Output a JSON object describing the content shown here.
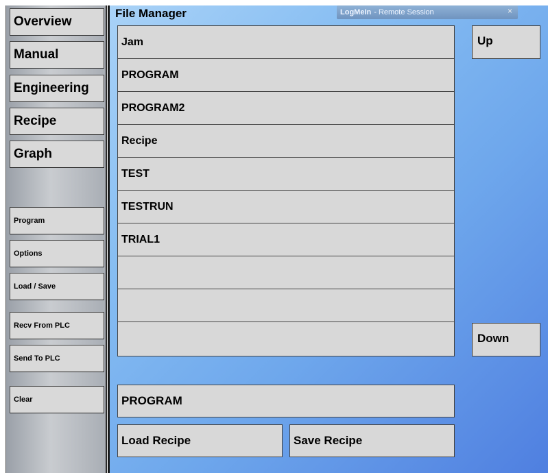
{
  "sidebar": {
    "nav": [
      "Overview",
      "Manual",
      "Engineering",
      "Recipe",
      "Graph"
    ],
    "actions": [
      "Program",
      "Options",
      "Load / Save",
      "Recv From PLC",
      "Send To PLC",
      "Clear"
    ]
  },
  "main": {
    "title": "File Manager",
    "files": [
      "Jam",
      "PROGRAM",
      "PROGRAM2",
      "Recipe",
      "TEST",
      "TESTRUN",
      "TRIAL1",
      "",
      "",
      ""
    ],
    "up_label": "Up",
    "down_label": "Down",
    "selected_recipe": "PROGRAM",
    "load_label": "Load Recipe",
    "save_label": "Save Recipe"
  },
  "logmein": {
    "brand": "LogMeIn",
    "session": "- Remote Session",
    "close_glyph": "×"
  },
  "colors": {
    "background_gradient_start": "#a9d2f7",
    "background_gradient_end": "#4f7fe0",
    "button_fill": "#d9d9d9"
  }
}
